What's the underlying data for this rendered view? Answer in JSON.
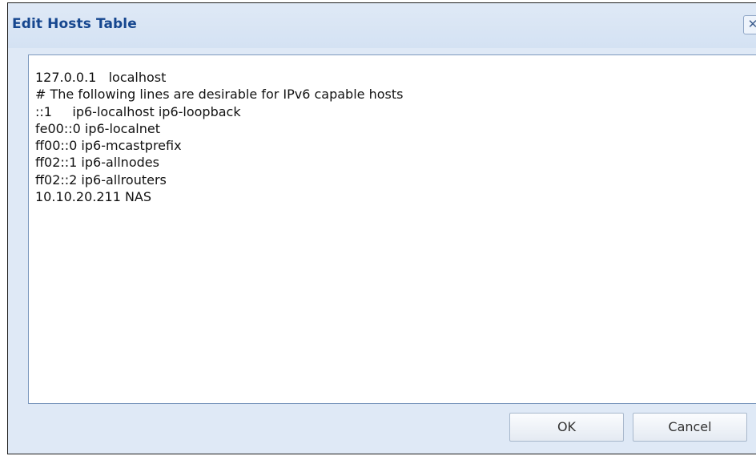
{
  "dialog": {
    "title": "Edit Hosts Table",
    "close_glyph": "✕",
    "close_icon": "close-icon"
  },
  "hosts_table": {
    "lines": [
      "127.0.0.1   localhost",
      "# The following lines are desirable for IPv6 capable hosts",
      "::1     ip6-localhost ip6-loopback",
      "fe00::0 ip6-localnet",
      "ff00::0 ip6-mcastprefix",
      "ff02::1 ip6-allnodes",
      "ff02::2 ip6-allrouters",
      "10.10.20.211 NAS"
    ]
  },
  "buttons": {
    "ok_label": "OK",
    "cancel_label": "Cancel"
  }
}
